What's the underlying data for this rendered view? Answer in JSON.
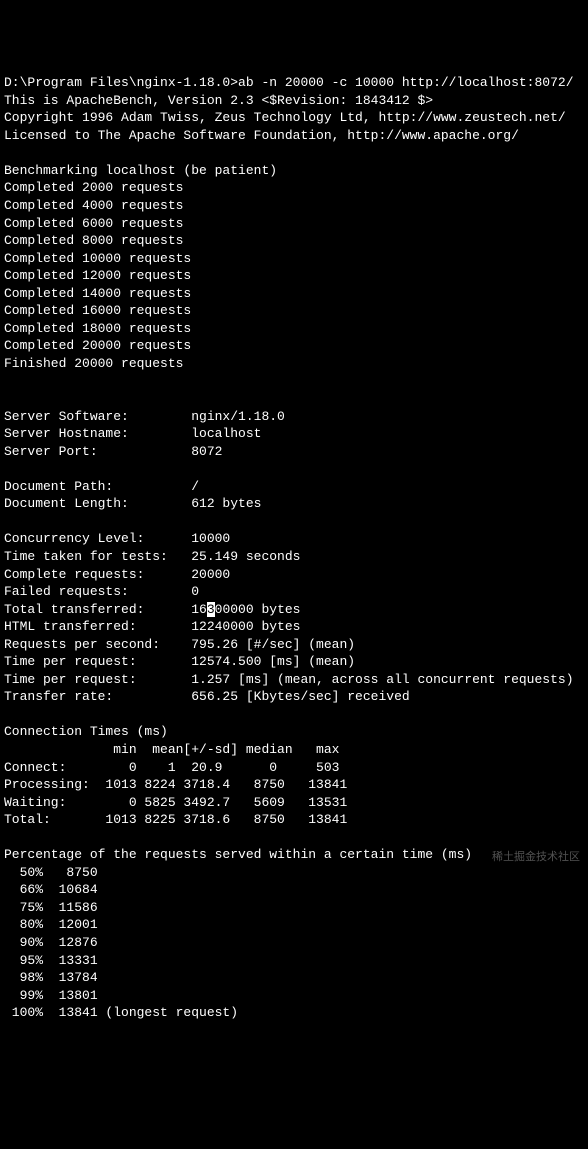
{
  "prompt": "D:\\Program Files\\nginx-1.18.0>ab -n 20000 -c 10000 http://localhost:8072/",
  "header": [
    "This is ApacheBench, Version 2.3 <$Revision: 1843412 $>",
    "Copyright 1996 Adam Twiss, Zeus Technology Ltd, http://www.zeustech.net/",
    "Licensed to The Apache Software Foundation, http://www.apache.org/"
  ],
  "benchmarking": "Benchmarking localhost (be patient)",
  "progress": [
    "Completed 2000 requests",
    "Completed 4000 requests",
    "Completed 6000 requests",
    "Completed 8000 requests",
    "Completed 10000 requests",
    "Completed 12000 requests",
    "Completed 14000 requests",
    "Completed 16000 requests",
    "Completed 18000 requests",
    "Completed 20000 requests",
    "Finished 20000 requests"
  ],
  "serverInfo": {
    "software": "Server Software:        nginx/1.18.0",
    "hostname": "Server Hostname:        localhost",
    "port": "Server Port:            8072"
  },
  "docInfo": {
    "path": "Document Path:          /",
    "length": "Document Length:        612 bytes"
  },
  "stats": {
    "concurrency": "Concurrency Level:      10000",
    "timeTaken": "Time taken for tests:   25.149 seconds",
    "complete": "Complete requests:      20000",
    "failed": "Failed requests:        0",
    "totalPre": "Total transferred:      16",
    "totalCursor": "3",
    "totalPost": "00000 bytes",
    "html": "HTML transferred:       12240000 bytes",
    "rps": "Requests per second:    795.26 [#/sec] (mean)",
    "tpr1": "Time per request:       12574.500 [ms] (mean)",
    "tpr2": "Time per request:       1.257 [ms] (mean, across all concurrent requests)",
    "transfer": "Transfer rate:          656.25 [Kbytes/sec] received"
  },
  "connTimes": {
    "title": "Connection Times (ms)",
    "head": "              min  mean[+/-sd] median   max",
    "connect": "Connect:        0    1  20.9      0     503",
    "process": "Processing:  1013 8224 3718.4   8750   13841",
    "waiting": "Waiting:        0 5825 3492.7   5609   13531",
    "total": "Total:       1013 8225 3718.6   8750   13841"
  },
  "percentiles": {
    "title": "Percentage of the requests served within a certain time (ms)",
    "rows": [
      "  50%   8750",
      "  66%  10684",
      "  75%  11586",
      "  80%  12001",
      "  90%  12876",
      "  95%  13331",
      "  98%  13784",
      "  99%  13801",
      " 100%  13841 (longest request)"
    ]
  },
  "watermark": "稀土掘金技术社区"
}
